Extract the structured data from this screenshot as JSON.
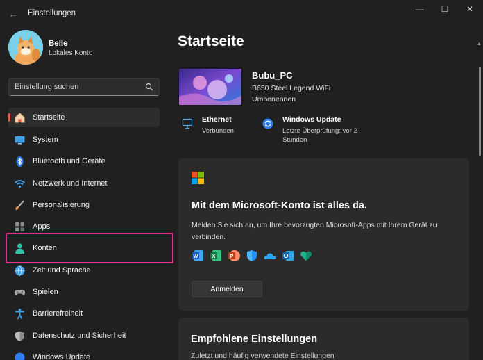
{
  "window": {
    "title": "Einstellungen",
    "controls": {
      "minimize": "—",
      "maximize": "☐",
      "close": "✕"
    },
    "back": "←"
  },
  "profile": {
    "name": "Belle",
    "account_type": "Lokales Konto"
  },
  "search": {
    "placeholder": "Einstellung suchen"
  },
  "sidebar": {
    "items": [
      {
        "label": "Startseite",
        "icon": "home-icon",
        "active": true
      },
      {
        "label": "System",
        "icon": "monitor-icon"
      },
      {
        "label": "Bluetooth und Geräte",
        "icon": "bluetooth-icon"
      },
      {
        "label": "Netzwerk und Internet",
        "icon": "wifi-icon"
      },
      {
        "label": "Personalisierung",
        "icon": "brush-icon"
      },
      {
        "label": "Apps",
        "icon": "apps-icon"
      },
      {
        "label": "Konten",
        "icon": "person-icon",
        "highlighted": true
      },
      {
        "label": "Zeit und Sprache",
        "icon": "globe-clock-icon"
      },
      {
        "label": "Spielen",
        "icon": "gamepad-icon"
      },
      {
        "label": "Barrierefreiheit",
        "icon": "accessibility-icon"
      },
      {
        "label": "Datenschutz und Sicherheit",
        "icon": "shield-icon"
      },
      {
        "label": "Windows Update",
        "icon": "update-icon"
      }
    ]
  },
  "main": {
    "title": "Startseite",
    "device": {
      "name": "Bubu_PC",
      "model": "B650 Steel Legend WiFi",
      "rename": "Umbenennen"
    },
    "status": [
      {
        "title": "Ethernet",
        "subtitle": "Verbunden",
        "icon": "ethernet-icon"
      },
      {
        "title": "Windows Update",
        "subtitle": "Letzte Überprüfung: vor 2 Stunden",
        "icon": "update-icon"
      }
    ],
    "ms_card": {
      "heading": "Mit dem Microsoft-Konto ist alles da.",
      "body": "Melden Sie sich an, um Ihre bevorzugten Microsoft-Apps mit Ihrem Gerät zu verbinden.",
      "button": "Anmelden",
      "apps": [
        "word-icon",
        "excel-icon",
        "powerpoint-icon",
        "defender-icon",
        "onedrive-icon",
        "outlook-icon",
        "family-icon"
      ]
    },
    "recommended_card": {
      "heading": "Empfohlene Einstellungen",
      "subtitle": "Zuletzt und häufig verwendete Einstellungen"
    }
  },
  "colors": {
    "accent": "#e85f4a",
    "highlight": "#e0318a",
    "background": "#202020",
    "card": "#2b2b2b"
  }
}
